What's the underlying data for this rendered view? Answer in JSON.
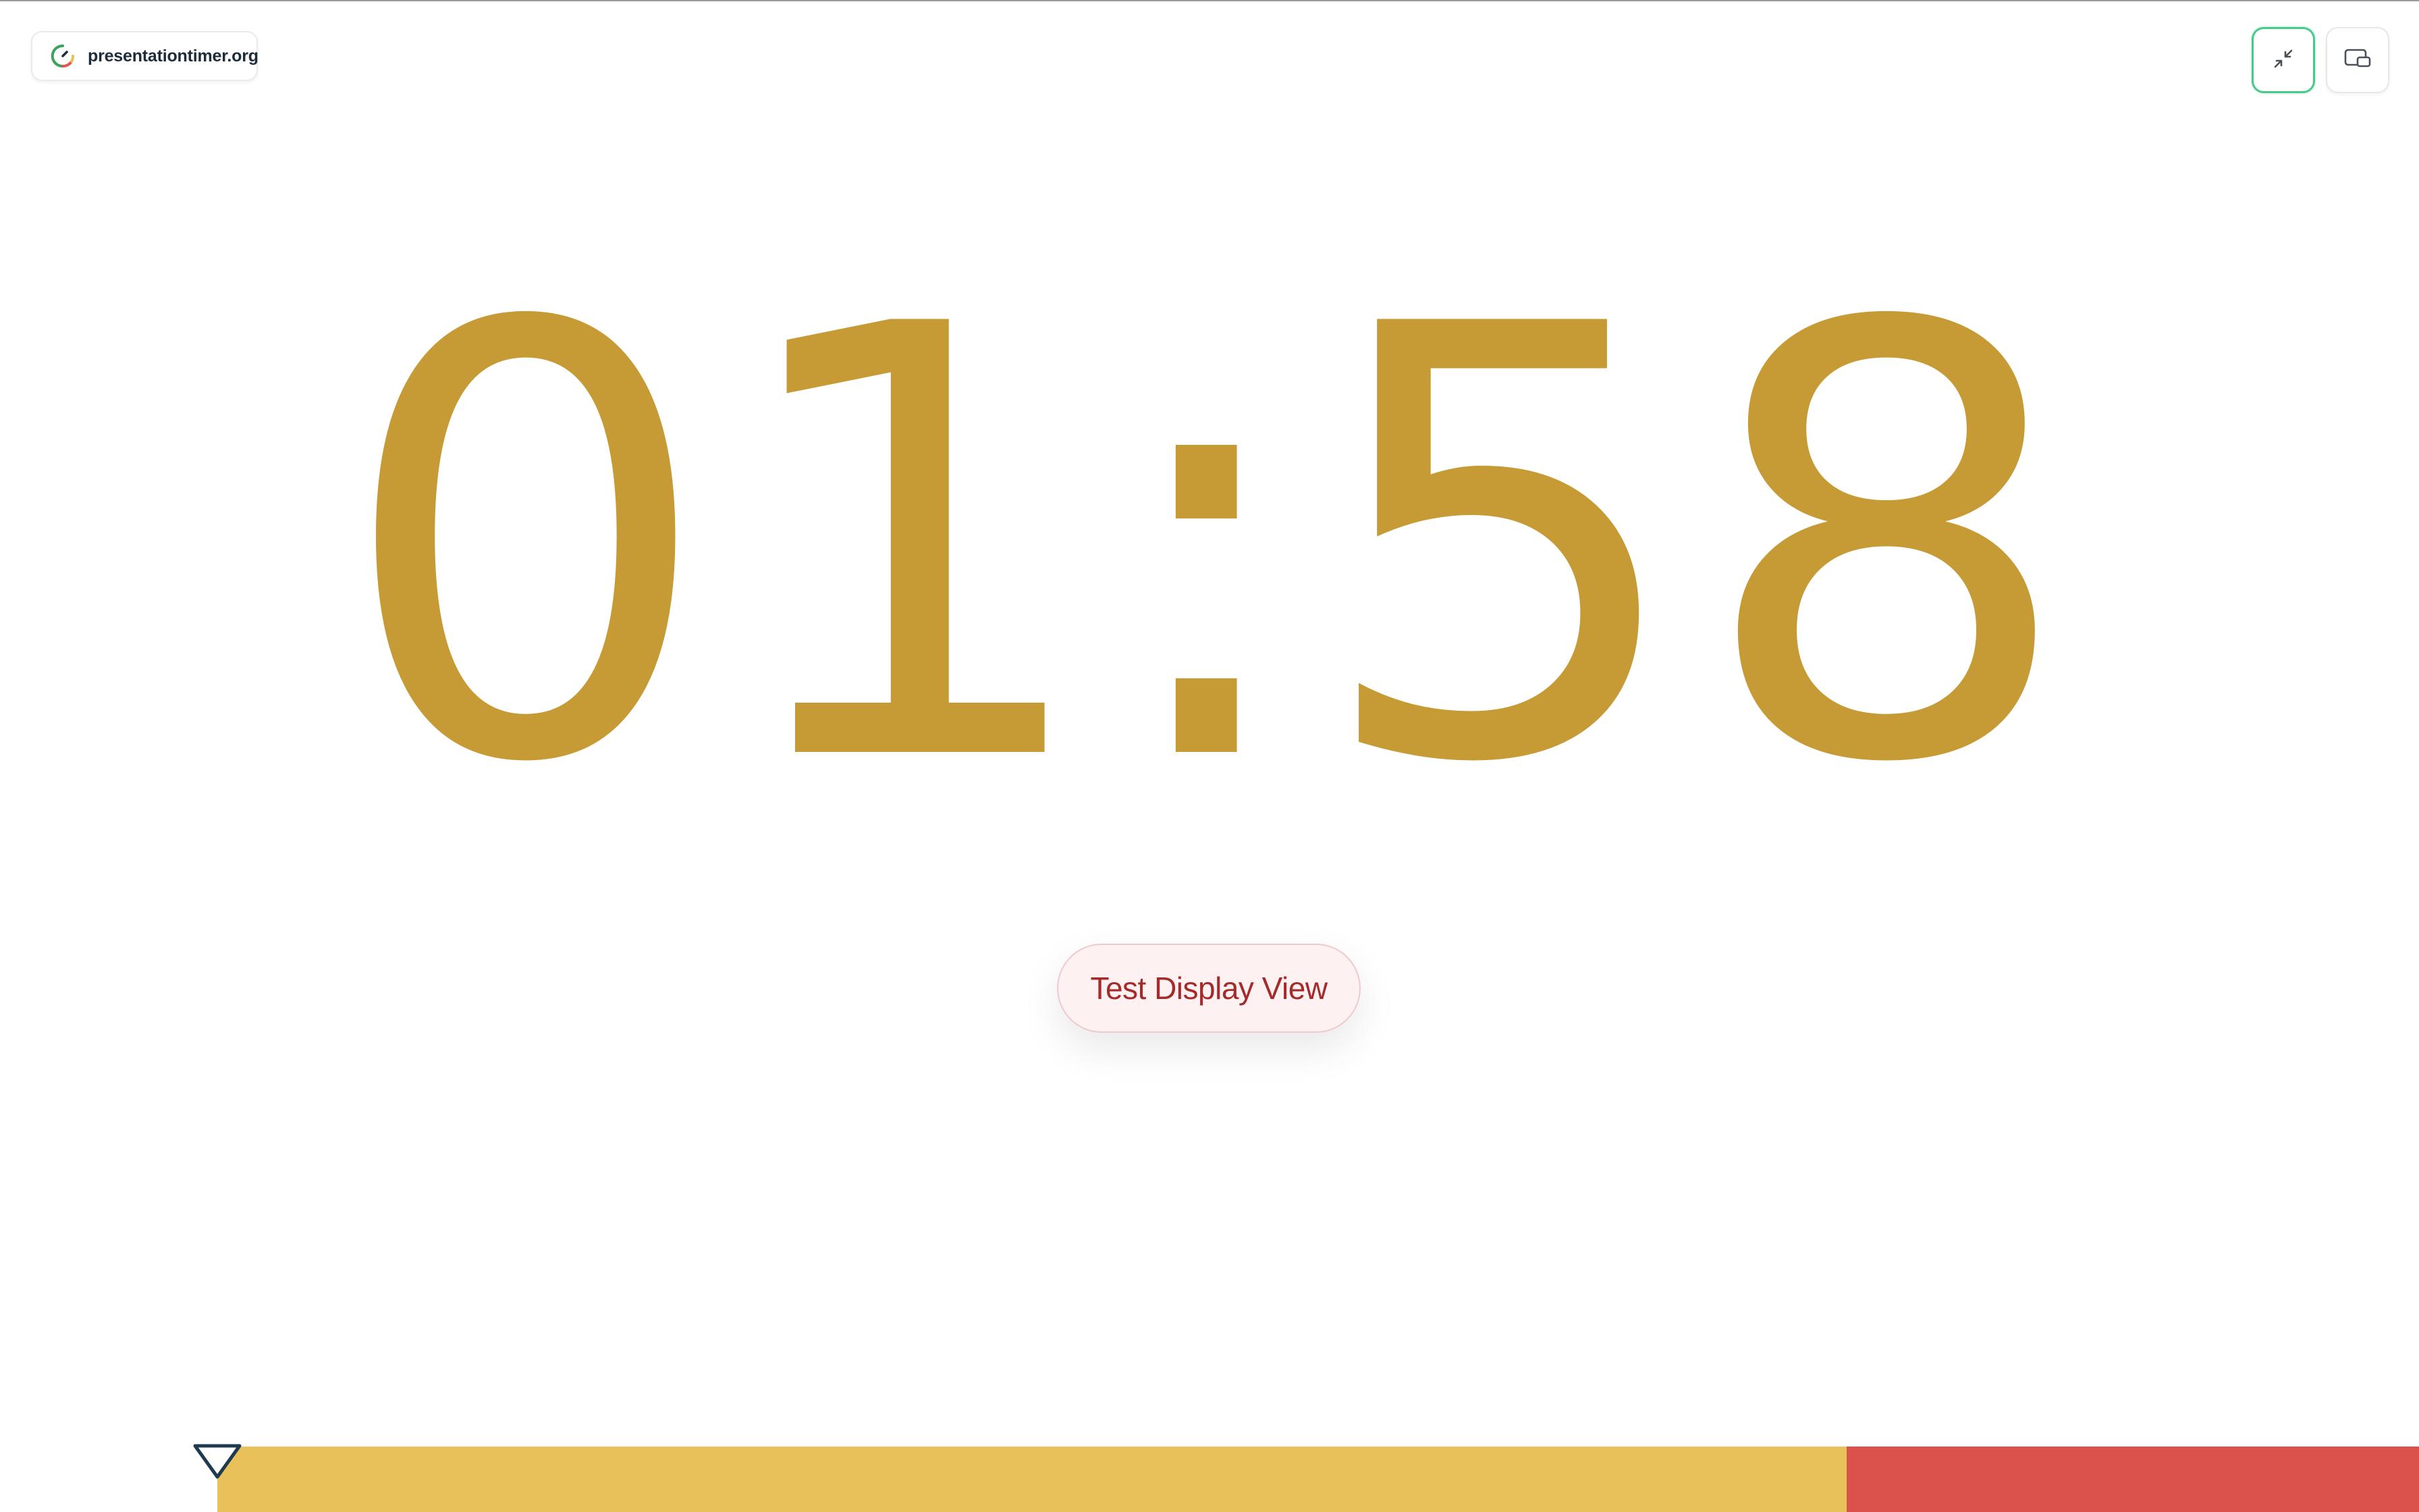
{
  "header": {
    "logo_text": "presentationtimer.org",
    "logo_icon": "gauge-icon"
  },
  "controls": {
    "minimize_icon": "minimize-arrows-icon",
    "display_icon": "screen-display-icon",
    "accent": "#47c98b"
  },
  "timer": {
    "display": "01:58",
    "color": "#c69a34"
  },
  "test_display": {
    "label": "Test Display View",
    "color": "#a52a2a"
  },
  "progress": {
    "warning_fraction": 0.74,
    "warning_color": "#e9c15b",
    "overtime_color": "#db524c",
    "marker_icon": "triangle-down-icon"
  }
}
